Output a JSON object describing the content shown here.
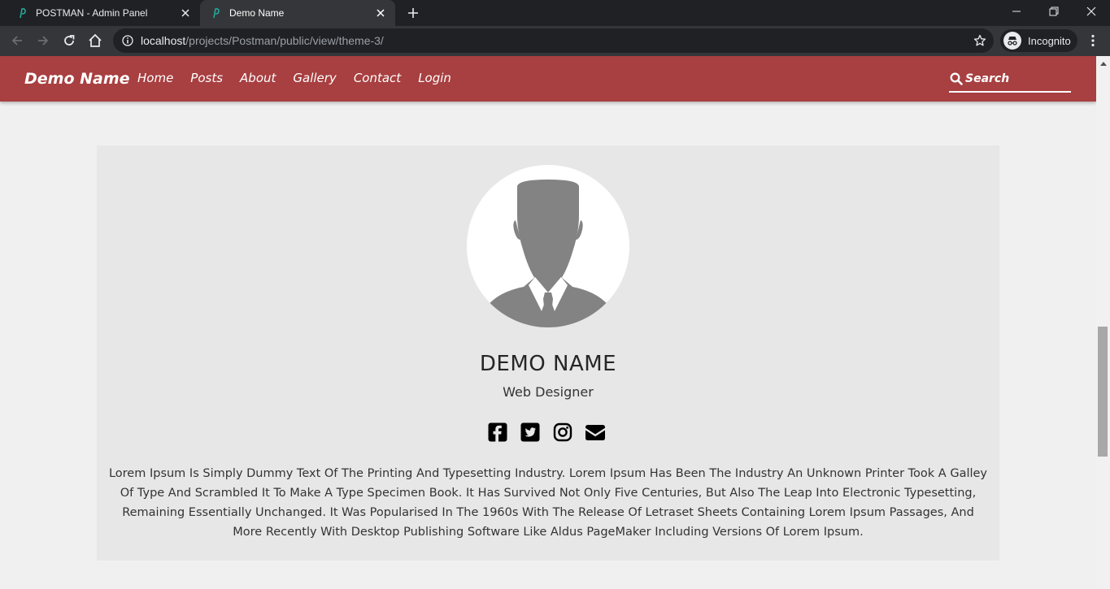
{
  "browser": {
    "tabs": [
      {
        "title": "POSTMAN - Admin Panel",
        "active": false
      },
      {
        "title": "Demo Name",
        "active": true
      }
    ],
    "url_host": "localhost",
    "url_path": "/projects/Postman/public/view/theme-3/",
    "profile_label": "Incognito"
  },
  "site": {
    "brand": "Demo Name",
    "nav": [
      "Home",
      "Posts",
      "About",
      "Gallery",
      "Contact",
      "Login"
    ],
    "search_placeholder": "Search",
    "colors": {
      "navbar": "#a83f40",
      "card": "#e7e7e7",
      "page": "#f0f0f0"
    }
  },
  "profile": {
    "name": "DEMO NAME",
    "role": "Web Designer",
    "socials": [
      "facebook-square-icon",
      "twitter-square-icon",
      "instagram-icon",
      "envelope-icon"
    ],
    "bio": "Lorem Ipsum Is Simply Dummy Text Of The Printing And Typesetting Industry. Lorem Ipsum Has Been The Industry An Unknown Printer Took A Galley Of Type And Scrambled It To Make A Type Specimen Book. It Has Survived Not Only Five Centuries, But Also The Leap Into Electronic Typesetting, Remaining Essentially Unchanged. It Was Popularised In The 1960s With The Release Of Letraset Sheets Containing Lorem Ipsum Passages, And More Recently With Desktop Publishing Software Like Aldus PageMaker Including Versions Of Lorem Ipsum."
  }
}
